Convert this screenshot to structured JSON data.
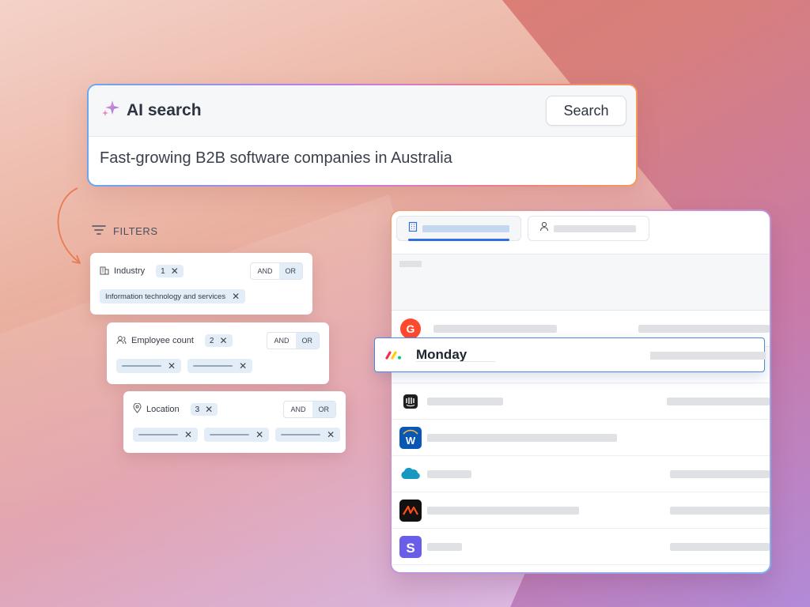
{
  "ai_search": {
    "title": "AI search",
    "button_label": "Search",
    "query": "Fast-growing B2B software companies in Australia",
    "sparkle_icon": "sparkle-icon"
  },
  "filters": {
    "label": "FILTERS",
    "items": [
      {
        "name": "Industry",
        "count": "1",
        "and_label": "AND",
        "or_label": "OR",
        "selected": "OR",
        "chips": [
          "Information technology and services"
        ],
        "icon": "building-icon"
      },
      {
        "name": "Employee count",
        "count": "2",
        "and_label": "AND",
        "or_label": "OR",
        "selected": "OR",
        "chips": [
          "",
          ""
        ],
        "icon": "users-icon"
      },
      {
        "name": "Location",
        "count": "3",
        "and_label": "AND",
        "or_label": "OR",
        "selected": "OR",
        "chips": [
          "",
          "",
          ""
        ],
        "icon": "map-pin-icon"
      }
    ]
  },
  "results": {
    "tabs": [
      {
        "icon": "building-icon",
        "active": true
      },
      {
        "icon": "person-icon",
        "active": false
      }
    ],
    "highlighted": {
      "name": "Monday",
      "logo": "monday-logo"
    },
    "rows": [
      {
        "logo": "g2-logo"
      },
      {
        "logo": "intercom-logo"
      },
      {
        "logo": "w-logo"
      },
      {
        "logo": "salesforce-logo"
      },
      {
        "logo": "orange-logo"
      },
      {
        "logo": "stripe-logo"
      },
      {
        "logo": "figma-logo"
      }
    ]
  },
  "colors": {
    "accent_blue": "#2f6fe0",
    "chip_bg": "#e3edf8",
    "arrow_orange": "#ea7b52"
  }
}
